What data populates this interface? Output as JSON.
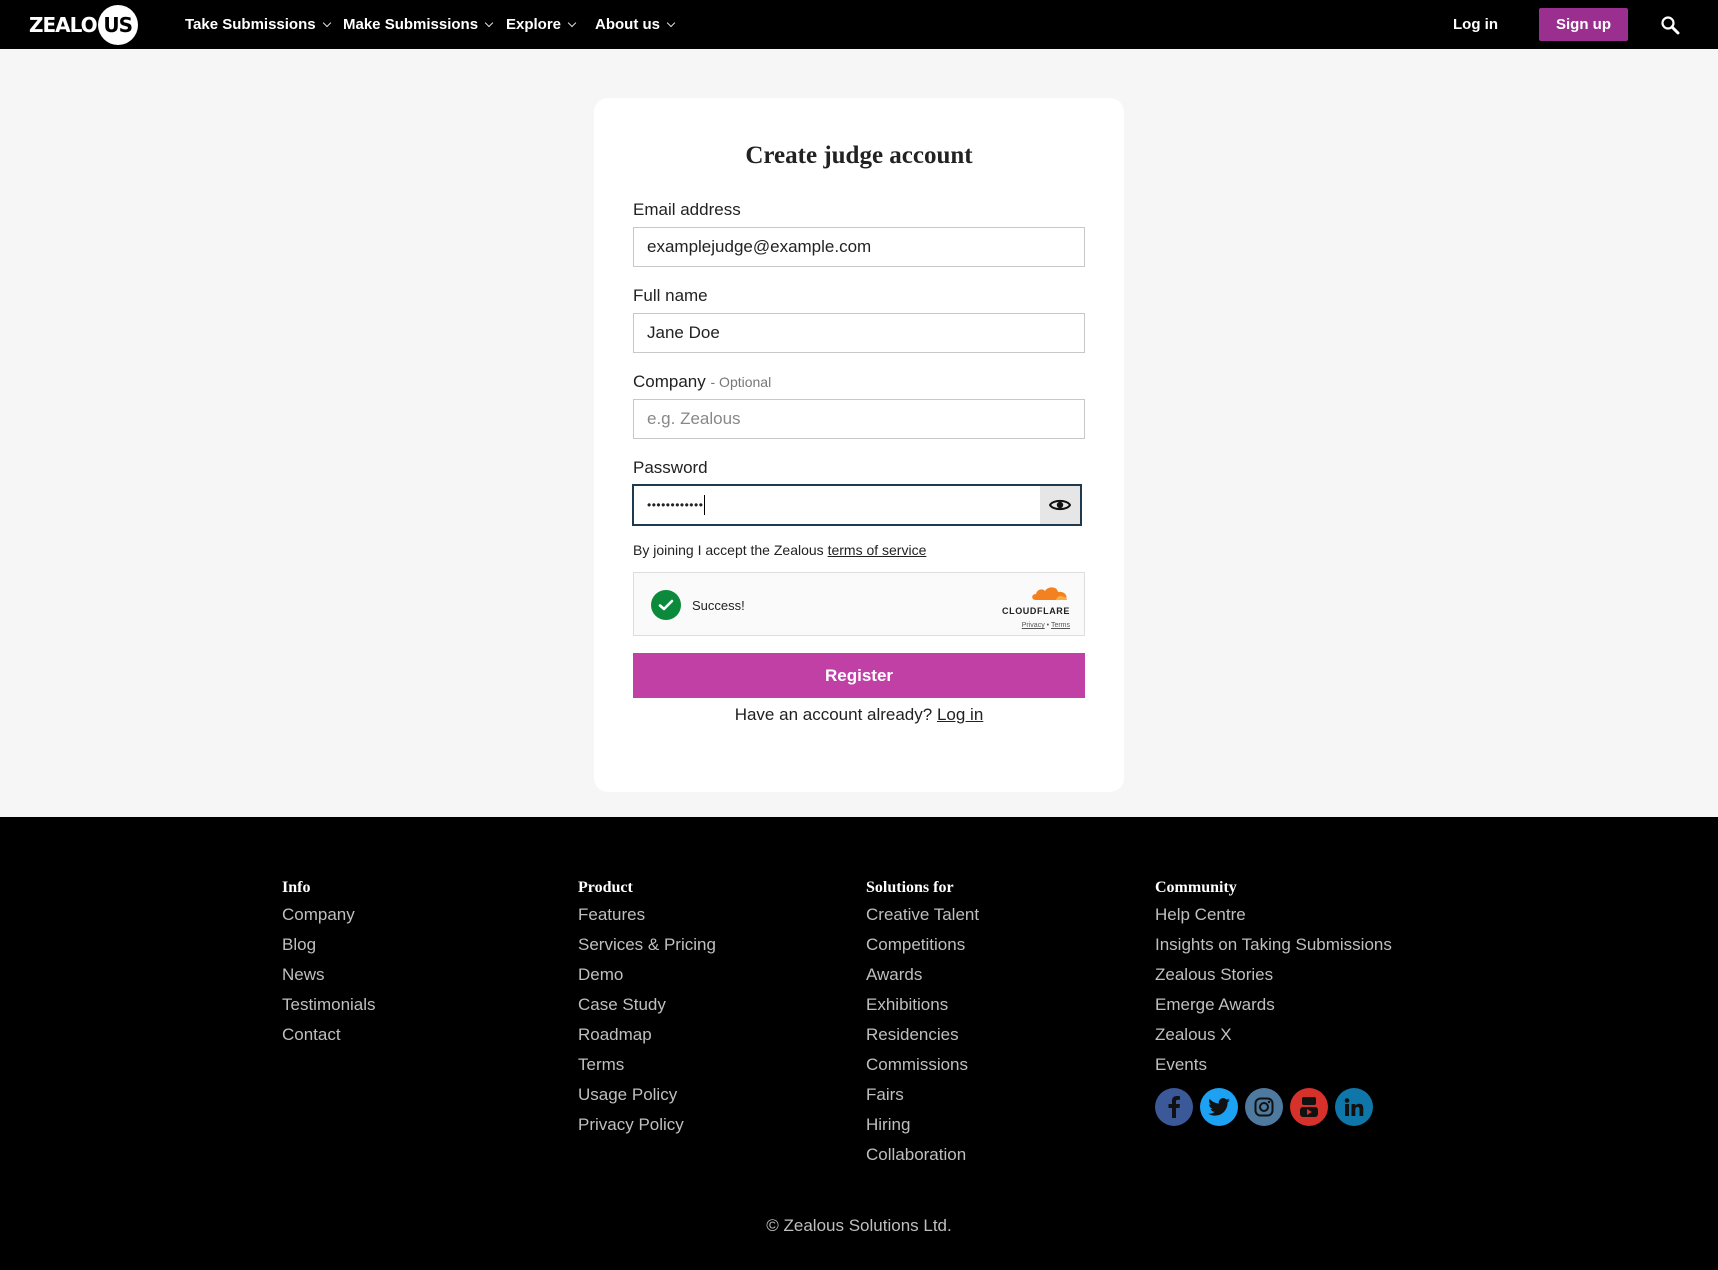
{
  "header": {
    "logo_text": "ZEALO",
    "logo_circle_text": "US",
    "nav": [
      {
        "label": "Take Submissions"
      },
      {
        "label": "Make Submissions"
      },
      {
        "label": "Explore"
      },
      {
        "label": "About us"
      }
    ],
    "login_label": "Log in",
    "signup_label": "Sign up"
  },
  "form": {
    "title": "Create judge account",
    "email": {
      "label": "Email address",
      "value": "examplejudge@example.com"
    },
    "full_name": {
      "label": "Full name",
      "value": "Jane Doe"
    },
    "company": {
      "label": "Company",
      "optional": "- Optional",
      "placeholder": "e.g. Zealous"
    },
    "password": {
      "label": "Password",
      "value": "••••••••••••"
    },
    "terms_prefix": "By joining I accept the Zealous",
    "terms_link": "terms of service",
    "captcha": {
      "status": "Success!",
      "provider": "CLOUDFLARE",
      "privacy": "Privacy",
      "separator": "•",
      "terms": "Terms"
    },
    "register_label": "Register",
    "have_account": "Have an account already?",
    "login_link": "Log in"
  },
  "footer": {
    "info": {
      "heading": "Info",
      "links": [
        "Company",
        "Blog",
        "News",
        "Testimonials",
        "Contact"
      ]
    },
    "product": {
      "heading": "Product",
      "links": [
        "Features",
        "Services & Pricing",
        "Demo",
        "Case Study",
        "Roadmap",
        "Terms",
        "Usage Policy",
        "Privacy Policy"
      ]
    },
    "solutions": {
      "heading": "Solutions for",
      "links": [
        "Creative Talent",
        "Competitions",
        "Awards",
        "Exhibitions",
        "Residencies",
        "Commissions",
        "Fairs",
        "Hiring",
        "Collaboration"
      ]
    },
    "community": {
      "heading": "Community",
      "links": [
        "Help Centre",
        "Insights on Taking Submissions",
        "Zealous Stories",
        "Emerge Awards",
        "Zealous X",
        "Events"
      ]
    },
    "socials": [
      {
        "name": "facebook-icon",
        "color": "#3b5998"
      },
      {
        "name": "twitter-icon",
        "color": "#1da1f2"
      },
      {
        "name": "instagram-icon",
        "color": "#4e7aa0"
      },
      {
        "name": "youtube-icon",
        "color": "#d6312b"
      },
      {
        "name": "linkedin-icon",
        "color": "#0e76a8"
      }
    ],
    "copyright": "© Zealous Solutions Ltd."
  },
  "colors": {
    "brand_purple": "#9b2f8f",
    "register_purple": "#c040a6",
    "success_green": "#0a8a3a",
    "focus_border": "#1f3a4f"
  }
}
